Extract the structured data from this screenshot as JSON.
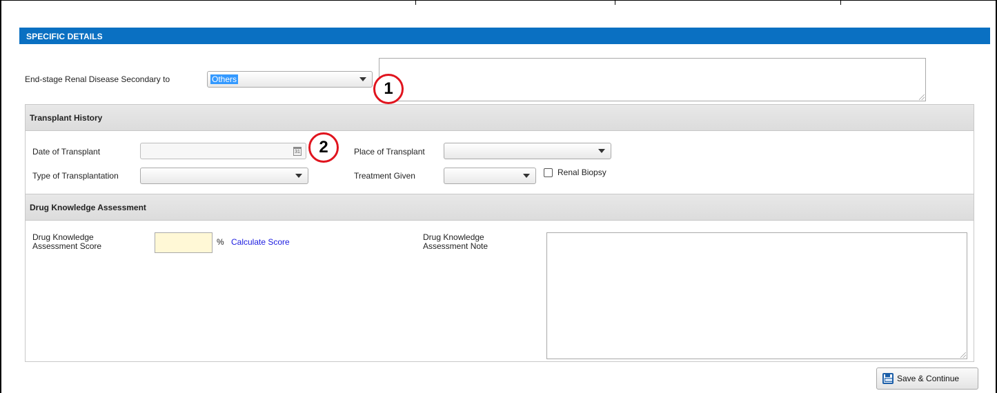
{
  "section": {
    "title": "SPECIFIC DETAILS"
  },
  "esrd": {
    "label": "End-stage Renal Disease Secondary to",
    "value": "Others"
  },
  "callouts": {
    "one": "1",
    "two": "2"
  },
  "transplant": {
    "header": "Transplant History",
    "date_label": "Date of Transplant",
    "date_value": "",
    "place_label": "Place of Transplant",
    "place_value": "",
    "type_label": "Type of Transplantation",
    "type_value": "",
    "treatment_label": "Treatment Given",
    "treatment_value": "",
    "biopsy_label": "Renal Biopsy",
    "biopsy_checked": false
  },
  "drug": {
    "header": "Drug Knowledge Assessment",
    "score_label_1": "Drug Knowledge",
    "score_label_2": "Assessment Score",
    "score_value": "",
    "percent": "%",
    "calculate_link": "Calculate Score",
    "note_label_1": "Drug Knowledge",
    "note_label_2": "Assessment Note",
    "note_value": ""
  },
  "actions": {
    "save_continue": "Save & Continue"
  },
  "colors": {
    "header_blue": "#0a70c2",
    "callout_red": "#e0141e",
    "score_bg": "#fff8d6",
    "link": "#1a1ae0"
  },
  "icons": {
    "calendar": "calendar-icon",
    "save": "save-icon",
    "dropdown": "chevron-down-icon"
  }
}
